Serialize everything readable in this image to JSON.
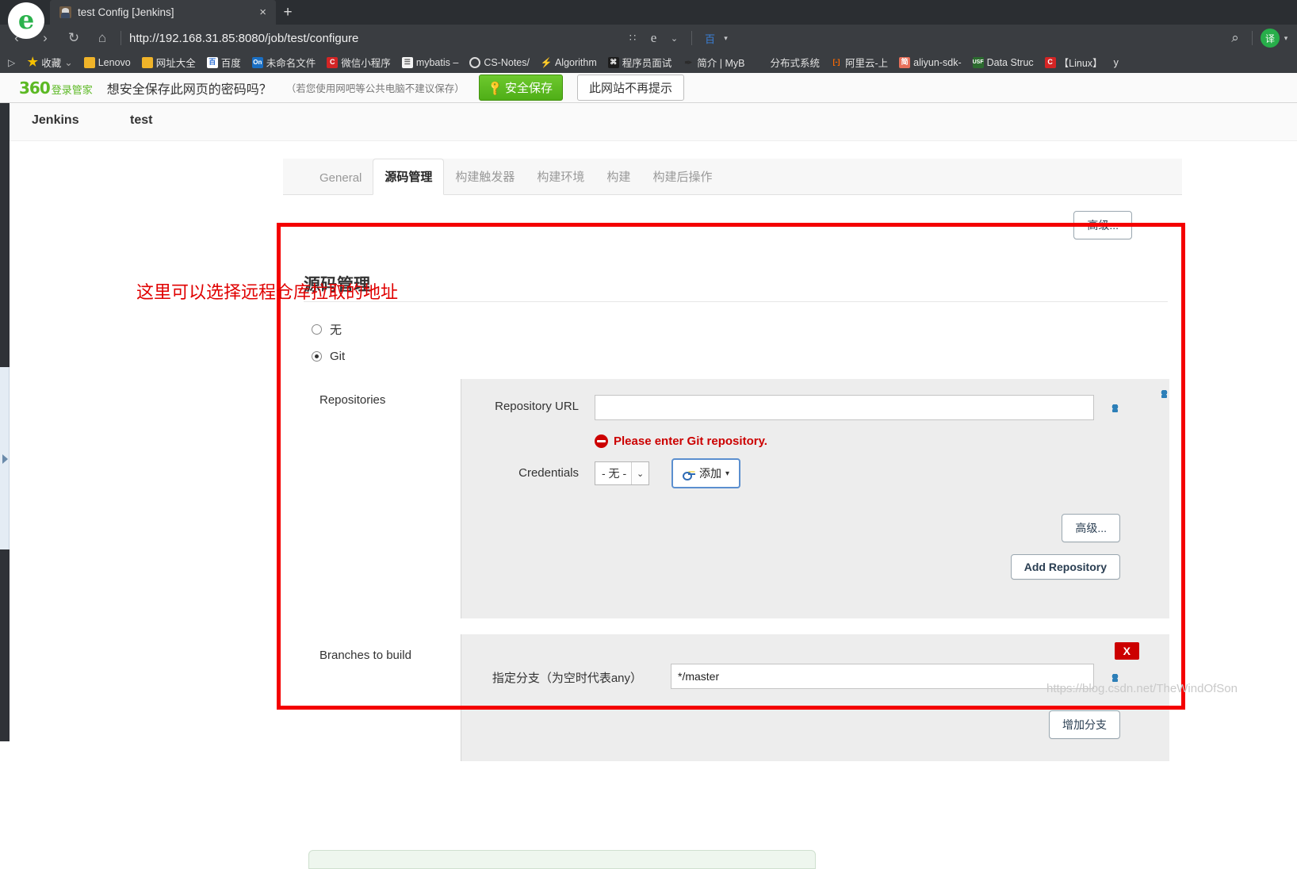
{
  "browser": {
    "tab": {
      "title": "test Config [Jenkins]",
      "favicon": "jenkins-favicon",
      "close": "×"
    },
    "newtab_label": "+",
    "nav": {
      "back": "‹",
      "forward": "›",
      "reload": "↻",
      "home": "⌂"
    },
    "url": "http://192.168.31.85:8080/job/test/configure",
    "right_icons": {
      "apps": "∷",
      "edge": "e",
      "chevron": "⌄",
      "baidu": "百",
      "baidu_caret": "▾",
      "search": "⌕",
      "translate": "译",
      "translate_caret": "▾"
    },
    "bookmarks_overflow": "▷",
    "bookmarks": [
      {
        "label": "收藏",
        "icon": "star-icon",
        "cls": "ico-star",
        "glyph": "★",
        "caret": "⌄"
      },
      {
        "label": "Lenovo",
        "icon": "folder-icon",
        "cls": "ico-folder",
        "glyph": ""
      },
      {
        "label": "网址大全",
        "icon": "folder-icon",
        "cls": "ico-folder",
        "glyph": ""
      },
      {
        "label": "百度",
        "icon": "baidu-icon",
        "cls": "ico-baidu",
        "glyph": "百"
      },
      {
        "label": "未命名文件",
        "icon": "onenote-icon",
        "cls": "ico-blue",
        "glyph": "On"
      },
      {
        "label": "微信小程序",
        "icon": "csdn-icon",
        "cls": "ico-red",
        "glyph": "C"
      },
      {
        "label": "mybatis –",
        "icon": "page-icon",
        "cls": "ico-white",
        "glyph": "☰"
      },
      {
        "label": "CS-Notes/",
        "icon": "github-icon",
        "cls": "ico-ring",
        "glyph": ""
      },
      {
        "label": "Algorithm",
        "icon": "algorithm-icon",
        "cls": "ico-none",
        "glyph": "⚡"
      },
      {
        "label": "程序员面试",
        "icon": "dark-icon",
        "cls": "ico-dark",
        "glyph": "⌘"
      },
      {
        "label": "简介 | MyB",
        "icon": "ink-icon",
        "cls": "ico-none",
        "glyph": "✒"
      },
      {
        "label": "分布式系统",
        "icon": "blank-icon",
        "cls": "ico-none",
        "glyph": ""
      },
      {
        "label": "阿里云-上",
        "icon": "aliyun-icon",
        "cls": "ico-none",
        "glyph": "[-]"
      },
      {
        "label": "aliyun-sdk-",
        "icon": "jian-icon",
        "cls": "ico-salmon",
        "glyph": "简"
      },
      {
        "label": "Data Struc",
        "icon": "usf-icon",
        "cls": "ico-green",
        "glyph": "USF"
      },
      {
        "label": "【Linux】",
        "icon": "csdn-icon",
        "cls": "ico-red",
        "glyph": "C"
      },
      {
        "label": "y",
        "icon": "blank-icon",
        "cls": "ico-none",
        "glyph": ""
      }
    ]
  },
  "password_bar": {
    "brand_number": "360",
    "brand_text": "登录管家",
    "question": "想安全保存此网页的密码吗？",
    "hint": "（若您使用网吧等公共电脑不建议保存）",
    "save_label": "安全保存",
    "save_icon": "key-icon",
    "never_label": "此网站不再提示"
  },
  "jenkins": {
    "breadcrumb": [
      "Jenkins",
      "test"
    ],
    "tabs": [
      {
        "label": "General",
        "active": false
      },
      {
        "label": "源码管理",
        "active": true
      },
      {
        "label": "构建触发器",
        "active": false
      },
      {
        "label": "构建环境",
        "active": false
      },
      {
        "label": "构建",
        "active": false
      },
      {
        "label": "构建后操作",
        "active": false
      }
    ],
    "advanced_top_label": "高级...",
    "scm": {
      "section_title": "源码管理",
      "options": [
        {
          "label": "无",
          "selected": false
        },
        {
          "label": "Git",
          "selected": true
        }
      ],
      "repositories_label": "Repositories",
      "repository_url_label": "Repository URL",
      "repository_url_value": "",
      "error_text": "Please enter Git repository.",
      "error_icon": "error-circle-icon",
      "credentials_label": "Credentials",
      "credentials_value": "- 无 -",
      "credentials_caret": "⌄",
      "add_button_label": "添加",
      "add_button_caret": "▾",
      "add_button_icon": "key-icon",
      "advanced_label": "高级...",
      "add_repository_label": "Add Repository",
      "branches_label": "Branches to build",
      "branch_spec_label": "指定分支（为空时代表any）",
      "branch_spec_value": "*/master",
      "delete_label": "X",
      "add_branch_label": "增加分支"
    }
  },
  "annotation": {
    "text": "这里可以选择远程仓库拉取的地址",
    "color": "#e00000",
    "box_color": "#f40000"
  },
  "watermark": {
    "text": "https://blog.csdn.net/TheWindOfSon"
  }
}
